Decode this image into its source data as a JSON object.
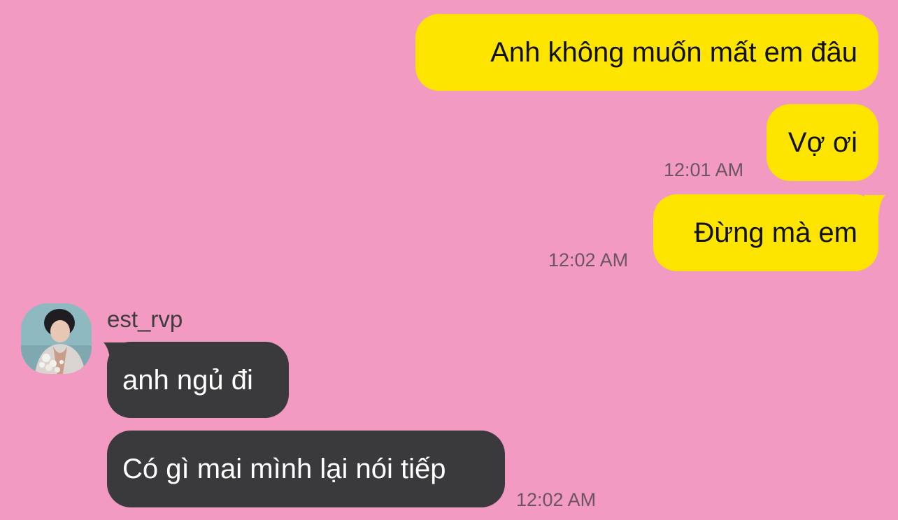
{
  "chat": {
    "colors": {
      "background": "#f29ac2",
      "outgoing_bubble": "#fee500",
      "incoming_bubble": "#3a3a3c",
      "timestamp": "#6b5560"
    },
    "outgoing": [
      {
        "text": "Anh không muốn mất em đâu"
      },
      {
        "text": "Vợ ơi",
        "time": "12:01 AM"
      },
      {
        "text": "Đừng mà em",
        "time": "12:02 AM"
      }
    ],
    "incoming": {
      "sender": "est_rvp",
      "messages": [
        {
          "text": "anh ngủ đi"
        },
        {
          "text": "Có gì mai mình lại nói tiếp",
          "time": "12:02 AM"
        }
      ]
    }
  }
}
